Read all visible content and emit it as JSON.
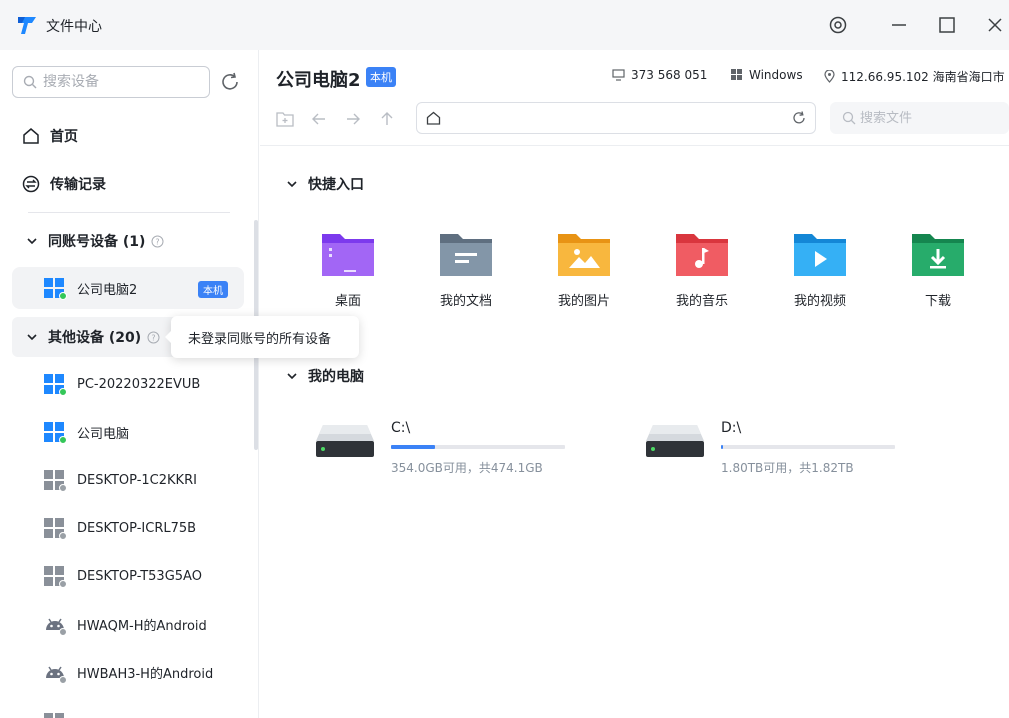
{
  "window": {
    "title": "文件中心"
  },
  "sidebar": {
    "search_placeholder": "搜索设备",
    "nav": [
      {
        "label": "首页",
        "icon": "home-icon"
      },
      {
        "label": "传输记录",
        "icon": "transfer-icon"
      }
    ],
    "groups": [
      {
        "title": "同账号设备 (1)",
        "devices": [
          {
            "name": "公司电脑2",
            "type": "windows",
            "online": true,
            "badge": "本机"
          }
        ]
      },
      {
        "title": "其他设备 (20)",
        "tooltip": "未登录同账号的所有设备",
        "devices": [
          {
            "name": "PC-20220322EVUB",
            "type": "windows",
            "online": true
          },
          {
            "name": "公司电脑",
            "type": "windows",
            "online": false
          },
          {
            "name": "DESKTOP-1C2KKRI",
            "type": "windows",
            "online": false
          },
          {
            "name": "DESKTOP-ICRL75B",
            "type": "windows",
            "online": false
          },
          {
            "name": "DESKTOP-T53G5AO",
            "type": "windows",
            "online": false
          },
          {
            "name": "HWAQM-H的Android",
            "type": "android",
            "online": false
          },
          {
            "name": "HWBAH3-H的Android",
            "type": "android",
            "online": false
          }
        ]
      }
    ]
  },
  "main": {
    "device_title": "公司电脑2",
    "device_badge": "本机",
    "info": {
      "id": "373 568 051",
      "os": "Windows",
      "ip_location": "112.66.95.102 海南省海口市"
    },
    "file_search_placeholder": "搜索文件",
    "quick_access": {
      "title": "快捷入口",
      "items": [
        {
          "label": "桌面",
          "icon": "desktop-folder-icon",
          "color": "#8b5cf6"
        },
        {
          "label": "我的文档",
          "icon": "documents-folder-icon",
          "color": "#7b8d9e"
        },
        {
          "label": "我的图片",
          "icon": "pictures-folder-icon",
          "color": "#f5a524"
        },
        {
          "label": "我的音乐",
          "icon": "music-folder-icon",
          "color": "#ef5350"
        },
        {
          "label": "我的视频",
          "icon": "videos-folder-icon",
          "color": "#26a4f0"
        },
        {
          "label": "下载",
          "icon": "downloads-folder-icon",
          "color": "#21a366"
        }
      ]
    },
    "my_computer": {
      "title": "我的电脑",
      "drives": [
        {
          "name": "C:\\",
          "size_text": "354.0GB可用，共474.1GB",
          "used_fraction": 0.25
        },
        {
          "name": "D:\\",
          "size_text": "1.80TB可用，共1.82TB",
          "used_fraction": 0.01
        }
      ]
    }
  },
  "colors": {
    "accent": "#3b82f6",
    "online": "#34c759",
    "offline": "#9aa0a6"
  }
}
